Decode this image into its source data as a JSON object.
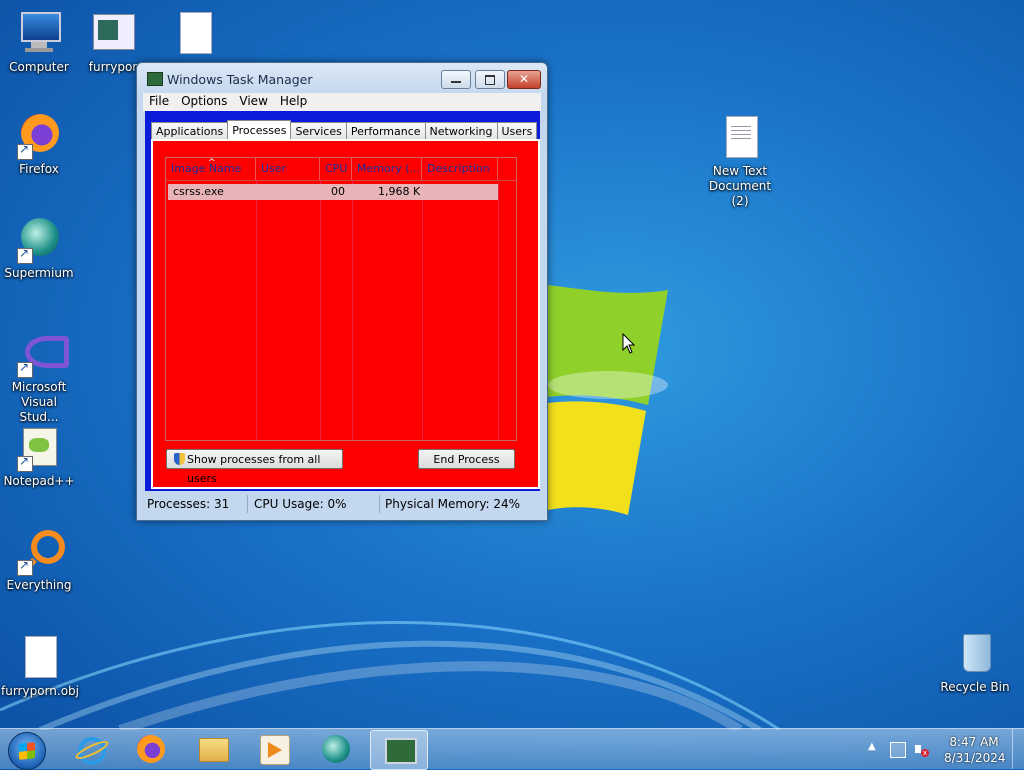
{
  "desktop": {
    "icons": [
      {
        "label": "Computer"
      },
      {
        "label": "furrypor"
      },
      {
        "label": ""
      },
      {
        "label": "Firefox"
      },
      {
        "label": "Supermium"
      },
      {
        "label": "Microsoft Visual Stud..."
      },
      {
        "label": "Notepad++"
      },
      {
        "label": "Everything"
      },
      {
        "label": "furryporn.obj"
      },
      {
        "label": "New Text Document (2)"
      },
      {
        "label": "Recycle Bin"
      }
    ]
  },
  "window": {
    "title": "Windows Task Manager",
    "close_glyph": "✕",
    "menu": [
      "File",
      "Options",
      "View",
      "Help"
    ],
    "tabs": [
      "Applications",
      "Processes",
      "Services",
      "Performance",
      "Networking",
      "Users"
    ],
    "active_tab": "Processes",
    "columns": [
      "Image Name",
      "User Name",
      "CPU",
      "Memory (...",
      "Description"
    ],
    "sort_glyph": "^",
    "rows": [
      {
        "image": "csrss.exe",
        "user": "",
        "cpu": "00",
        "memory": "1,968 K",
        "description": ""
      }
    ],
    "buttons": {
      "show_all": "Show processes from all users",
      "end_process": "End Process"
    },
    "status": {
      "processes": "Processes: 31",
      "cpu": "CPU Usage: 0%",
      "memory": "Physical Memory: 24%"
    },
    "colors": {
      "panel": "#ff0000",
      "client": "#0a1bd9",
      "row_selected": "#e8b4b8"
    }
  },
  "taskbar": {
    "items": [
      "start-orb",
      "internet-explorer-icon",
      "firefox-icon",
      "file-explorer-icon",
      "media-player-icon",
      "supermium-icon",
      "task-manager-icon"
    ],
    "active_item": "task-manager-icon",
    "clock": {
      "time": "8:47 AM",
      "date": "8/31/2024"
    }
  }
}
